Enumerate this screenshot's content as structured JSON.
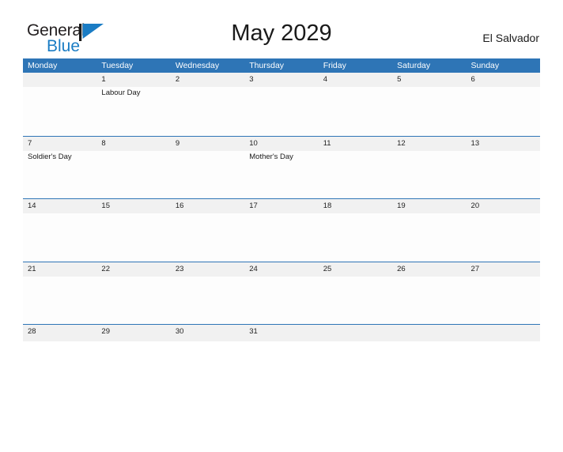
{
  "brand": {
    "name_part1": "General",
    "name_part2": "Blue",
    "mark_icon": "triangle-flag-icon",
    "color_dark": "#231f20",
    "color_blue": "#1a7cc4"
  },
  "header": {
    "title": "May 2029",
    "country": "El Salvador"
  },
  "calendar": {
    "accent_color": "#2e75b6",
    "date_band_color": "#f1f1f1",
    "weekdays": [
      "Monday",
      "Tuesday",
      "Wednesday",
      "Thursday",
      "Friday",
      "Saturday",
      "Sunday"
    ],
    "weeks": [
      [
        {
          "num": "",
          "events": []
        },
        {
          "num": "1",
          "events": [
            "Labour Day"
          ]
        },
        {
          "num": "2",
          "events": []
        },
        {
          "num": "3",
          "events": []
        },
        {
          "num": "4",
          "events": []
        },
        {
          "num": "5",
          "events": []
        },
        {
          "num": "6",
          "events": []
        }
      ],
      [
        {
          "num": "7",
          "events": [
            "Soldier's Day"
          ]
        },
        {
          "num": "8",
          "events": []
        },
        {
          "num": "9",
          "events": []
        },
        {
          "num": "10",
          "events": [
            "Mother's Day"
          ]
        },
        {
          "num": "11",
          "events": []
        },
        {
          "num": "12",
          "events": []
        },
        {
          "num": "13",
          "events": []
        }
      ],
      [
        {
          "num": "14",
          "events": []
        },
        {
          "num": "15",
          "events": []
        },
        {
          "num": "16",
          "events": []
        },
        {
          "num": "17",
          "events": []
        },
        {
          "num": "18",
          "events": []
        },
        {
          "num": "19",
          "events": []
        },
        {
          "num": "20",
          "events": []
        }
      ],
      [
        {
          "num": "21",
          "events": []
        },
        {
          "num": "22",
          "events": []
        },
        {
          "num": "23",
          "events": []
        },
        {
          "num": "24",
          "events": []
        },
        {
          "num": "25",
          "events": []
        },
        {
          "num": "26",
          "events": []
        },
        {
          "num": "27",
          "events": []
        }
      ],
      [
        {
          "num": "28",
          "events": []
        },
        {
          "num": "29",
          "events": []
        },
        {
          "num": "30",
          "events": []
        },
        {
          "num": "31",
          "events": []
        },
        {
          "num": "",
          "events": []
        },
        {
          "num": "",
          "events": []
        },
        {
          "num": "",
          "events": []
        }
      ]
    ]
  }
}
